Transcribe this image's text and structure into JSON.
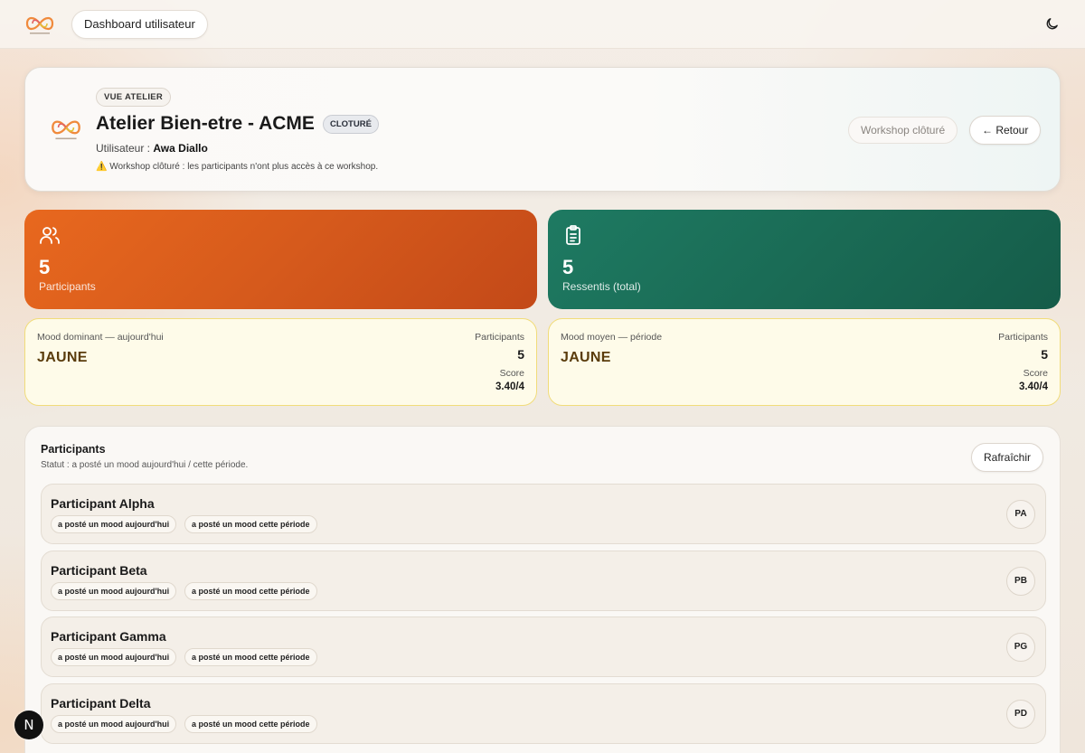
{
  "topbar": {
    "dashboard_label": "Dashboard utilisateur"
  },
  "header": {
    "view_badge": "VUE ATELIER",
    "title": "Atelier Bien-etre - ACME",
    "status_badge": "CLOTURÉ",
    "user_prefix": "Utilisateur : ",
    "user_name": "Awa Diallo",
    "warning_icon": "⚠️",
    "warning_text": " Workshop clôturé : les participants n'ont plus accès à ce workshop.",
    "closed_button": "Workshop clôturé",
    "back_button": "← Retour"
  },
  "stats": {
    "participants": {
      "value": "5",
      "label": "Participants",
      "icon": "users-icon"
    },
    "ressentis": {
      "value": "5",
      "label": "Ressentis (total)",
      "icon": "clipboard-icon"
    }
  },
  "moods": {
    "today": {
      "title": "Mood dominant — aujourd'hui",
      "value": "JAUNE",
      "participants_label": "Participants",
      "participants_value": "5",
      "score_label": "Score",
      "score_value": "3.40/4"
    },
    "period": {
      "title": "Mood moyen — période",
      "value": "JAUNE",
      "participants_label": "Participants",
      "participants_value": "5",
      "score_label": "Score",
      "score_value": "3.40/4"
    }
  },
  "participants_panel": {
    "title": "Participants",
    "subtitle": "Statut : a posté un mood aujourd'hui / cette période.",
    "refresh_button": "Rafraîchir",
    "rows": [
      {
        "name": "Participant Alpha",
        "chip_today": "a posté un mood aujourd'hui",
        "chip_period": "a posté un mood cette période",
        "initials": "PA"
      },
      {
        "name": "Participant Beta",
        "chip_today": "a posté un mood aujourd'hui",
        "chip_period": "a posté un mood cette période",
        "initials": "PB"
      },
      {
        "name": "Participant Gamma",
        "chip_today": "a posté un mood aujourd'hui",
        "chip_period": "a posté un mood cette période",
        "initials": "PG"
      },
      {
        "name": "Participant Delta",
        "chip_today": "a posté un mood aujourd'hui",
        "chip_period": "a posté un mood cette période",
        "initials": "PD"
      }
    ]
  },
  "devtools": {
    "badge": "N"
  },
  "colors": {
    "orange_card": "#e8681e",
    "green_card": "#1e7a62",
    "mood_bg": "#fefbe9",
    "mood_value": "#5a3c0c"
  }
}
